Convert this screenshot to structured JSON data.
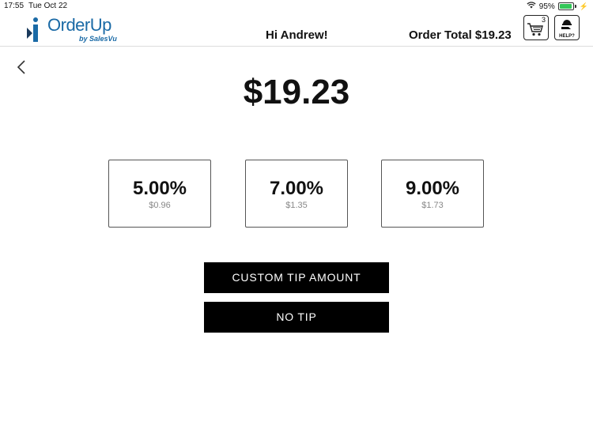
{
  "status_bar": {
    "time": "17:55",
    "date": "Tue Oct 22",
    "battery_text": "95%",
    "battery_level": 0.95,
    "battery_color": "#34c759"
  },
  "header": {
    "logo": {
      "name": "OrderUp",
      "sub": "by SalesVu",
      "brand_color": "#1a6aa6"
    },
    "greeting": "Hi Andrew!",
    "order_total": "Order Total $19.23",
    "cart_count": "3",
    "help_label": "HELP?"
  },
  "main": {
    "amount": "$19.23",
    "tip_options": [
      {
        "percent": "5.00%",
        "amount": "$0.96"
      },
      {
        "percent": "7.00%",
        "amount": "$1.35"
      },
      {
        "percent": "9.00%",
        "amount": "$1.73"
      }
    ],
    "custom_tip_label": "CUSTOM TIP AMOUNT",
    "no_tip_label": "NO TIP"
  },
  "icons": [
    "wifi-icon",
    "battery-icon",
    "cart-icon",
    "help-icon",
    "back-chevron-icon"
  ]
}
